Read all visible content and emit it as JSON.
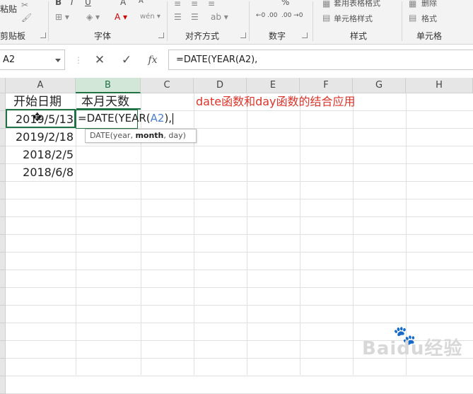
{
  "ribbon": {
    "groups": [
      "剪贴板",
      "字体",
      "对齐方式",
      "数字",
      "样式",
      "单元格"
    ],
    "paste_label": "粘贴",
    "styles_items": [
      "套用表格格式",
      "单元格样式"
    ],
    "cells_items": [
      "删除",
      "格式"
    ],
    "font_buttons": [
      "B",
      "I",
      "U",
      "A",
      "A"
    ],
    "number_symbols": [
      "%",
      "←0 .00",
      ".00 →0"
    ]
  },
  "formula_bar": {
    "name_box": "A2",
    "cancel_symbol": "✕",
    "enter_symbol": "✓",
    "fx_label": "fx",
    "formula": "=DATE(YEAR(A2),"
  },
  "sheet": {
    "columns": [
      "A",
      "B",
      "C",
      "D",
      "E",
      "F",
      "G",
      "H"
    ],
    "selected_column": "B",
    "cells": {
      "A1": "开始日期",
      "B1": "本月天数",
      "A2": "2019/5/13",
      "A3": "2019/2/18",
      "A4": "2018/2/5",
      "A5": "2018/6/8"
    },
    "title_note": "date函数和day函数的结合应用",
    "title_color": "#d9342b",
    "edit_text_start": "=DATE(YEAR(",
    "edit_text_ref": "A2",
    "edit_text_end": "),",
    "tooltip_func": "DATE(year, ",
    "tooltip_bold": "month",
    "tooltip_rest": ", day)"
  },
  "watermark": "Baidu经验",
  "colors": {
    "excel_green": "#217346",
    "ref_blue": "#4a7fc8"
  }
}
